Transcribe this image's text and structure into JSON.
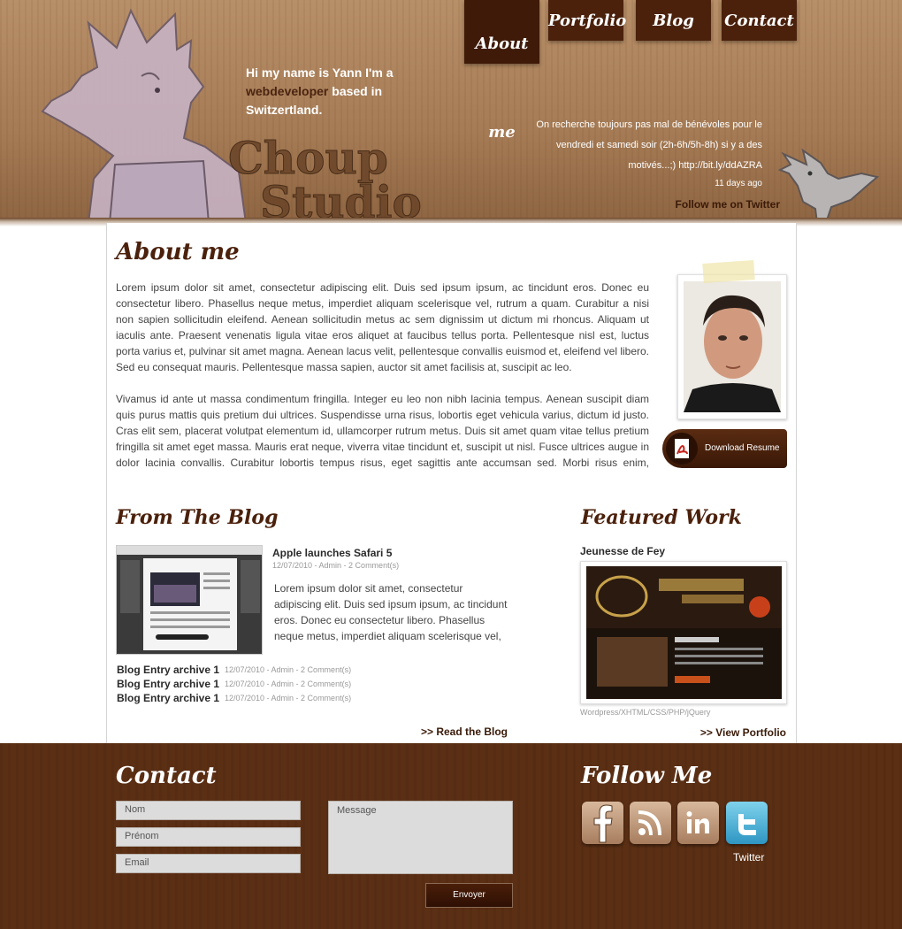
{
  "header": {
    "intro_line1": "Hi my name is Yann I'm a",
    "intro_accent": "webdeveloper",
    "intro_line2": " based in",
    "intro_line3": "Switzertland.",
    "logo_line1": "Choup",
    "logo_line2": "Studio",
    "nav": {
      "about": "About me",
      "portfolio": "Portfolio",
      "blog": "Blog",
      "contact": "Contact"
    },
    "tweet_text": "On recherche toujours pas mal de bénévoles pour le vendredi et samedi soir (2h-6h/5h-8h) si y a des motivés...;) http://bit.ly/ddAZRA",
    "tweet_time": "11 days ago",
    "follow_twitter": "Follow me on Twitter"
  },
  "about": {
    "title": "About me",
    "p1": "Lorem ipsum dolor sit amet, consectetur adipiscing elit. Duis sed ipsum ipsum, ac tincidunt eros. Donec eu consectetur libero. Phasellus neque metus, imperdiet aliquam scelerisque vel, rutrum a quam. Curabitur a nisi non sapien sollicitudin eleifend. Aenean sollicitudin metus ac sem dignissim ut dictum mi rhoncus. Aliquam ut iaculis ante. Praesent venenatis ligula vitae eros aliquet at faucibus tellus porta. Pellentesque nisl est, luctus porta varius et, pulvinar sit amet magna. Aenean lacus velit, pellentesque convallis euismod et, eleifend vel libero. Sed eu consequat mauris. Pellentesque massa sapien, auctor sit amet facilisis at, suscipit ac leo.",
    "p2": "Vivamus id ante ut massa condimentum fringilla. Integer eu leo non nibh lacinia tempus. Aenean suscipit diam quis purus mattis quis pretium dui ultrices. Suspendisse urna risus, lobortis eget vehicula varius, dictum id justo. Cras elit sem, placerat volutpat elementum id, ullamcorper rutrum metus. Duis sit amet quam vitae tellus pretium fringilla sit amet eget massa. Mauris erat neque, viverra vitae tincidunt et, suscipit ut nisl. Fusce ultrices augue in dolor lacinia convallis. Curabitur lobortis tempus risus, eget sagittis ante accumsan sed. Morbi risus enim, eleifend ac",
    "resume_button": "Download Resume"
  },
  "blog": {
    "title": "From The Blog",
    "post_title": "Apple launches Safari 5",
    "post_meta": "12/07/2010 - Admin - 2 Comment(s)",
    "post_excerpt": "Lorem ipsum dolor sit amet, consectetur adipiscing elit. Duis sed ipsum ipsum, ac tincidunt eros. Donec eu consectetur libero. Phasellus neque metus, imperdiet aliquam scelerisque vel,",
    "archive": [
      {
        "title": "Blog Entry archive 1",
        "meta": "12/07/2010 - Admin - 2 Comment(s)"
      },
      {
        "title": "Blog Entry archive 1",
        "meta": "12/07/2010 - Admin - 2 Comment(s)"
      },
      {
        "title": "Blog Entry archive 1",
        "meta": "12/07/2010 - Admin - 2 Comment(s)"
      }
    ],
    "read_link": ">> Read the Blog"
  },
  "work": {
    "title": "Featured Work",
    "project_name": "Jeunesse de Fey",
    "project_tech": "Wordpress/XHTML/CSS/PHP/jQuery",
    "view_link": ">> View Portfolio"
  },
  "contact": {
    "title": "Contact",
    "field_nom": "Nom",
    "field_prenom": "Prénom",
    "field_email": "Email",
    "field_message": "Message",
    "send_button": "Envoyer"
  },
  "follow": {
    "title": "Follow Me",
    "icons": [
      "facebook-icon",
      "rss-icon",
      "linkedin-icon",
      "twitter-icon"
    ],
    "twitter_label": "Twitter"
  },
  "colors": {
    "brand_brown": "#4b210c",
    "header_tan": "#a57b55",
    "footer_brown": "#5b2f14",
    "twitter_blue": "#2e96c2"
  }
}
